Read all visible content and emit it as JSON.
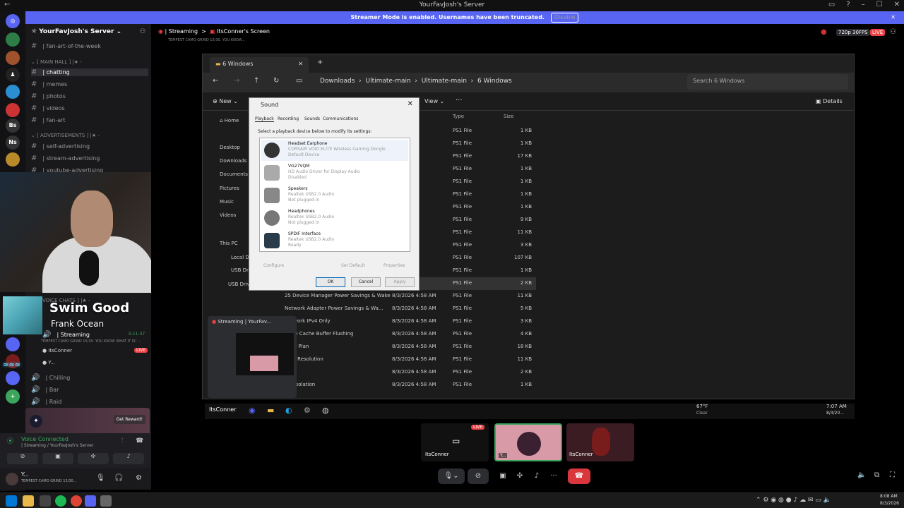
{
  "app": {
    "window_title": "YourFavJosh's Server"
  },
  "streamer_mode": {
    "message": "Streamer Mode is enabled. Usernames have been truncated.",
    "disable_label": "Disable"
  },
  "server": {
    "name": "YourFavJosh's Server"
  },
  "channels": {
    "fan_art_week": "| fan-art-of-the-week",
    "main_hall_cat": "[ MAIN HALL ] |★ -",
    "chatting": "| chatting",
    "memes": "| memes",
    "photos": "| photos",
    "videos": "| videos",
    "fan_art": "| fan-art",
    "ads_cat": "[ ADVERTISEMENTS ] |★ -",
    "self_adv": "| self-advertising",
    "stream_adv": "| stream-advertising",
    "yt_adv": "| youtube-advertising",
    "voice_cat": "VOICE CHATS ] |★ -",
    "streaming": "| Streaming",
    "streaming_timer": "5:11:37",
    "streaming_sub": "TEMPEST CAMO GRIND 15/30. YOU KNOW WHAT IT IS! ...",
    "itsconner": "ItsConner",
    "live": "LIVE",
    "y_user": "Y...",
    "chilling": "| Chilling",
    "bar": "| Bar",
    "raid": "| Raid"
  },
  "header": {
    "channel": "| Streaming",
    "screen": "ItsConner's Screen",
    "sub": "TEMPEST CAMO GRIND 15/30. YOU KNOW...",
    "quality": "720p 30FPS",
    "live": "LIVE"
  },
  "guilds": [
    "Bs",
    "Ns"
  ],
  "song": {
    "title": "Swim Good",
    "artist": "Frank Ocean"
  },
  "reward": {
    "label": "Get Reward!"
  },
  "voice": {
    "status": "Voice Connected",
    "where": "| Streaming / YourFavJosh's Server"
  },
  "user": {
    "name": "Y...",
    "status": "TEMPEST CAMO GRIND 15/30..."
  },
  "explorer": {
    "tab_title": "6 Windows",
    "crumbs": [
      "Downloads",
      "Ultimate-main",
      "Ultimate-main",
      "6 Windows"
    ],
    "search_placeholder": "Search 6 Windows",
    "new_label": "New",
    "view_label": "View",
    "details_label": "Details",
    "nav": [
      "Home",
      "Desktop",
      "Downloads",
      "Documents",
      "Pictures",
      "Music",
      "Videos",
      "This PC",
      "Local Disk",
      "USB Drive",
      "USB Drive"
    ],
    "col_type": "Type",
    "col_size": "Size",
    "rows": [
      {
        "name": "",
        "date": "AM",
        "type": "PS1 File",
        "size": "1 KB"
      },
      {
        "name": "",
        "date": "AM",
        "type": "PS1 File",
        "size": "1 KB"
      },
      {
        "name": "",
        "date": "AM",
        "type": "PS1 File",
        "size": "17 KB"
      },
      {
        "name": "",
        "date": "AM",
        "type": "PS1 File",
        "size": "1 KB"
      },
      {
        "name": "",
        "date": "AM",
        "type": "PS1 File",
        "size": "1 KB"
      },
      {
        "name": "",
        "date": "AM",
        "type": "PS1 File",
        "size": "1 KB"
      },
      {
        "name": "",
        "date": "AM",
        "type": "PS1 File",
        "size": "1 KB"
      },
      {
        "name": "",
        "date": "AM",
        "type": "PS1 File",
        "size": "9 KB"
      },
      {
        "name": "",
        "date": "AM",
        "type": "PS1 File",
        "size": "11 KB"
      },
      {
        "name": "",
        "date": "AM",
        "type": "PS1 File",
        "size": "3 KB"
      },
      {
        "name": "",
        "date": "AM",
        "type": "PS1 File",
        "size": "107 KB"
      },
      {
        "name": "",
        "date": "AM",
        "type": "PS1 File",
        "size": "1 KB"
      },
      {
        "name": "",
        "date": "AM",
        "type": "PS1 File",
        "size": "2 KB"
      },
      {
        "name": "25 Device Manager Power Savings & Wake",
        "date": "8/3/2026 4:58 AM",
        "type": "PS1 File",
        "size": "11 KB"
      },
      {
        "name": "Network Adapter Power Savings & Wa...",
        "date": "8/3/2026 4:58 AM",
        "type": "PS1 File",
        "size": "5 KB"
      },
      {
        "name": "Network IPv4 Only",
        "date": "8/3/2026 4:58 AM",
        "type": "PS1 File",
        "size": "3 KB"
      },
      {
        "name": "Write Cache Buffer Flushing",
        "date": "8/3/2026 4:58 AM",
        "type": "PS1 File",
        "size": "4 KB"
      },
      {
        "name": "ower Plan",
        "date": "8/3/2026 4:58 AM",
        "type": "PS1 File",
        "size": "18 KB"
      },
      {
        "name": "imer Resolution",
        "date": "8/3/2026 4:58 AM",
        "type": "PS1 File",
        "size": "11 KB"
      },
      {
        "name": "AC",
        "date": "8/3/2026 4:58 AM",
        "type": "PS1 File",
        "size": "2 KB"
      },
      {
        "name": "ore Isolation",
        "date": "8/3/2026 4:58 AM",
        "type": "PS1 File",
        "size": "1 KB"
      }
    ]
  },
  "sound": {
    "title": "Sound",
    "tabs": [
      "Playback",
      "Recording",
      "Sounds",
      "Communications"
    ],
    "instruction": "Select a playback device below to modify its settings:",
    "devices": [
      {
        "name": "Headset Earphone",
        "driver": "CORSAIR VOID ELITE Wireless Gaming Dongle",
        "state": "Default Device"
      },
      {
        "name": "VG27VQM",
        "driver": "HD Audio Driver for Display Audio",
        "state": "Disabled"
      },
      {
        "name": "Speakers",
        "driver": "Realtek USB2.0 Audio",
        "state": "Not plugged in"
      },
      {
        "name": "Headphones",
        "driver": "Realtek USB2.0 Audio",
        "state": "Not plugged in"
      },
      {
        "name": "SPDIF Interface",
        "driver": "Realtek USB2.0 Audio",
        "state": "Ready"
      }
    ],
    "configure": "Configure",
    "set_default": "Set Default",
    "properties": "Properties",
    "ok": "OK",
    "cancel": "Cancel",
    "apply": "Apply"
  },
  "popout": {
    "title": "Streaming | YourFav..."
  },
  "stream_taskbar": {
    "item": "ItsConner",
    "weather_temp": "67°F",
    "weather_text": "Clear",
    "time": "7:07 AM",
    "date": "8/3/20..."
  },
  "tiles": [
    {
      "label": "ItsConner",
      "live": "LIVE"
    },
    {
      "label": "Y..."
    },
    {
      "label": "ItsConner"
    }
  ],
  "clock": {
    "time": "8:08 AM",
    "date": "8/3/2026"
  }
}
